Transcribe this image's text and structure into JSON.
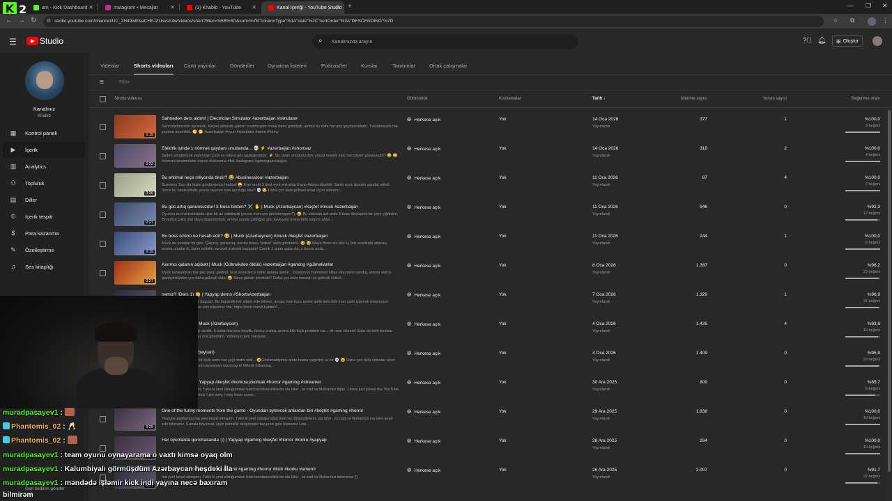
{
  "browser": {
    "tabs": [
      {
        "label": "am - Kick Dashboard",
        "color": "#53fc18"
      },
      {
        "label": "Instagram • Mesajlar",
        "color": "#d6249f"
      },
      {
        "label": "(3) Khabib - YouTube",
        "color": "#ff0000"
      },
      {
        "label": "Kanal içeriği - YouTube Studio",
        "color": "#ff0000"
      }
    ],
    "url": "studio.youtube.com/channel/UC_3H49wElsaCHEJZUsvsX4w/videos/short?filter=%5B%5D&sort=%7B\"columnType\"%3A\"date\"%2C\"sortOrder\"%3A\"DESCENDING\"%7D"
  },
  "overlay": {
    "kick_logo_letter": "K",
    "kick_logo_number": "2"
  },
  "header": {
    "logo_text": "Studio",
    "search_placeholder": "Kanalınızda arayın",
    "create_label": "Oluştur"
  },
  "sidebar": {
    "channel_name": "Kanalınız",
    "channel_handle": "Khabib",
    "items": [
      {
        "label": "Kontrol paneli",
        "icon": "dashboard-icon"
      },
      {
        "label": "İçerik",
        "icon": "content-icon"
      },
      {
        "label": "Analytics",
        "icon": "analytics-icon"
      },
      {
        "label": "Topluluk",
        "icon": "community-icon"
      },
      {
        "label": "Diller",
        "icon": "subtitles-icon"
      },
      {
        "label": "İçerik tespiti",
        "icon": "copyright-icon"
      },
      {
        "label": "Para kazanma",
        "icon": "monetization-icon"
      },
      {
        "label": "Özelleştirme",
        "icon": "customization-icon"
      },
      {
        "label": "Ses kitaplığı",
        "icon": "audio-library-icon"
      }
    ],
    "feedback_label": "Geri bildirim gönder"
  },
  "content_tabs": [
    "Videolar",
    "Shorts videoları",
    "Canlı yayınlar",
    "Gönderiler",
    "Oynatma listeleri",
    "Podcast'ler",
    "Kurslar",
    "Tanıtımlar",
    "Ortak çalışmalar"
  ],
  "active_tab": "Shorts videoları",
  "filter_placeholder": "Filtre",
  "columns": {
    "video": "Shorts videosu",
    "visibility": "Görünürlük",
    "restrictions": "Kısıtlamalar",
    "date": "Tarih",
    "views": "İzlenme sayısı",
    "comments": "Yorum sayısı",
    "likes": "Beğenme oranı"
  },
  "rows": [
    {
      "title": "Sahnədən dərs aldım! | Electrician Simulator #azerbaijan #simulator",
      "desc": "Sahnələrimizdən öyrənirik. Keçən videoda şəkləri unutmuşam məne baha gəlmişdi, amma bu dəfə hər şey qaydasındadır. Təhlükəsizlik hər şeyden önəmlidir. 😁 😁 #azerbaijan #oyun #simulator #tamir #funny",
      "duration": "0:19",
      "visibility": "Herkese açık",
      "restrictions": "Yok",
      "date": "14 Oca 2026",
      "date_status": "Yayınlandı",
      "views": "377",
      "comments": "1",
      "like_ratio": "%100,0",
      "like_count": "3 beğeni",
      "like_fraction": 1.0,
      "thumb": [
        "#8a3a22",
        "#d86a3a"
      ]
    },
    {
      "title": "Elektrik işində 1 nömrəli qaydanı unudanda... 💀 ⚡ #azerbaijan #shortsaz",
      "desc": "Şalteri söndürmək yadımdan çıxdı və nəticə göz qabağındadır. ⚡ Siz cisarı söndürürdün, yoxsa mənim kimi 'təcrübəni' güvənərdin? 😂 😂 #electriciansimulator #oyun #təkrurma #fail #azlagram #gamingazerbaijan",
      "duration": "0:22",
      "visibility": "Herkese açık",
      "restrictions": "Yok",
      "date": "14 Oca 2026",
      "date_status": "Yayınlandı",
      "views": "318",
      "comments": "2",
      "like_ratio": "%100,0",
      "like_count": "4 beğeni",
      "like_fraction": 1.0,
      "thumb": [
        "#4a4c6a",
        "#8a6f8a"
      ]
    },
    {
      "title": "Bu ehtimal neçə milyonda birdir? 😂 #businesstour #azerbaijan",
      "desc": "Business Tour-da bizim gördüyümüz hadisə! 😂 Eyni anda 3 dost eyni ərd-arda Kayıp Adaya düşdük. Sanki oyun bizimlə zarafat edirdi. Sizcə bu bəxtsizlikdir, yoxsa oyunun bizə qurduğu tələ? 💀 😂 Daha çox belə gülməli anlar üçün videonu...",
      "duration": "0:26",
      "visibility": "Herkese açık",
      "restrictions": "Yok",
      "date": "11 Oca 2026",
      "date_status": "Yayınlandı",
      "views": "87",
      "comments": "4",
      "like_ratio": "%100,0",
      "like_count": "7 beğeni",
      "like_fraction": 1.0,
      "thumb": [
        "#9aa08a",
        "#d8d8c0"
      ]
    },
    {
      "title": "Bu güc artıq qanunsuzdur! 3 Boss birden? ⚔️ ✋ | Muck (Azərbaycan) #keşfet #muck #azerbaijan",
      "desc": "Oyunun bu mərhələsində işlər bir az ciddiləşdi (yoxsa mən çox güclənmişəm?). 😂 Bu videoda ard-arda 3 boss döyüşünü bir yerə yığdıdım. Ərvvəlcə çətin olar deyə düşünürdüm, amma sonda çatdığım güc səviyyəsi mənə belə sürpriz oldu!...",
      "duration": "0:27",
      "visibility": "Herkese açık",
      "restrictions": "Yok",
      "date": "11 Oca 2026",
      "date_status": "Yayınlandı",
      "views": "946",
      "comments": "0",
      "like_ratio": "%92,3",
      "like_count": "12 beğeni",
      "like_fraction": 0.923,
      "thumb": [
        "#3a4a6a",
        "#7a8ab0"
      ]
    },
    {
      "title": "Bu boss özünü nə hesab edir? 😂 | Muck (Azərbaycan) #muck #keşfet #azerbaijan",
      "desc": "Muck-da sıradan bir gün; Qaçırıq, qorxuruq, axırda bossu \"paket\" edib göndəririk. 😂 😂 Wave Boss elə bilir ki, bizi asanlıqla udacaq, amma unudur ki, bizim millətin survival instinkti başqadır! Canlılı 1 qram qalsa da, o bossu orda...",
      "duration": "0:19",
      "visibility": "Herkese açık",
      "restrictions": "Yok",
      "date": "11 Oca 2026",
      "date_status": "Yayınlandı",
      "views": "244",
      "comments": "1",
      "like_ratio": "%100,0",
      "like_count": "6 beğeni",
      "like_fraction": 1.0,
      "thumb": [
        "#3a4a7a",
        "#8a9ac8"
      ]
    },
    {
      "title": "Axırıncı qalanın aqibəti | Muck (Gülməkdən öldük) #azerbaijan #gaming #gülməlianlar",
      "desc": "Muck oynayarkən hər şey yaxşı gedirdi, ta ki sona bircə nəfər qalana qədər... Dostumuz həmmisin killas ekacəyini sandıq, amma nəticə gözləyirmizdən çox daha gülməli oldu! 😂 Sizcə günah kimdedir? Daha çox belə maraqlı və gülməli videol...",
      "duration": "0:27",
      "visibility": "Herkese açık",
      "restrictions": "Yok",
      "date": "8 Oca 2026",
      "date_status": "Yayınlandı",
      "views": "1.387",
      "comments": "0",
      "like_ratio": "%96,2",
      "like_count": "25 beğeni",
      "like_fraction": 0.962,
      "thumb": [
        "#a0301a",
        "#e8a040"
      ]
    },
    {
      "title": "nəmiz? (Dərs 1) 👶 | Yapyap demo #ShortsAzerbaijan",
      "desc": "əşələm, hamı düçəktə başsarı. Bu harakətli hər adam edə bilməz, ancaq mən bura qədər gəlib belə bilə mən canlı izləmək istəyirsəsə aşağıdakı linkdən keçid edə bilərsiniz link: https://kick.com/Khabib00...",
      "duration": "0:27",
      "visibility": "Herkese açık",
      "restrictions": "Yok",
      "date": "7 Oca 2026",
      "date_status": "Yayınlandı",
      "views": "1.329",
      "comments": "1",
      "like_ratio": "%96,9",
      "like_count": "31 beğeni",
      "like_fraction": 0.969,
      "thumb": [
        "#2a2a3a",
        "#5a5a6a"
      ]
    },
    {
      "title": "mən ölürəm? 💀 | Muck (Azərbaycan)",
      "desc": "l bossu kəsməyə qərar verdik. 5 nəfər hücuma keçdik, bossu yıxdıq, amma bilir kiçik problem var... ək mən ölürəm! Sizin də belə bəxtsiz dostunuz var? Videonu ona göndərin. Videonun tam versiyası...",
      "duration": "0:27",
      "visibility": "Herkese açık",
      "restrictions": "Yok",
      "date": "4 Oca 2026",
      "date_status": "Yayınlandı",
      "views": "1.426",
      "comments": "4",
      "like_ratio": "%93,8",
      "like_count": "15 beğeni",
      "like_fraction": 0.938,
      "thumb": [
        "#2a2a3a",
        "#5a5a6a"
      ]
    },
    {
      "title": "qdıq! | Muck (Azərbaycan)",
      "desc": "ck oynayırdıq, amma bir kiçik səhv hər şeyi məhv etdi... 😂Gözlənədiyimiz anda bossu çağırdıq və bir 💀 😂 Daha çox belə videolar üçün kanala abune olmağı və bəyənməyi unutmayın! #Muck #Gaming...",
      "duration": "0:27",
      "visibility": "Herkese açık",
      "restrictions": "Yok",
      "date": "4 Oca 2026",
      "date_status": "Yayınlandı",
      "views": "1.409",
      "comments": "0",
      "like_ratio": "%95,8",
      "like_count": "23 beğeni",
      "like_fraction": 0.958,
      "thumb": [
        "#2a2a3a",
        "#5a5a6a"
      ]
    },
    {
      "title": "çik suprizi 😂 😂 | Yapyap #keşfet #korkusuzkorkak #horror #gaming #streamer",
      "desc": "ma yeni keçid etmişəm. Təbii ki yeni olduğumdan bədi təcrübəsizliklərim ola bilər , öz irad və fikirlərinizi ibjan. I have just joined the YouTube platform. Of course, since I am new, I may have some...",
      "duration": "0:27",
      "visibility": "Herkese açık",
      "restrictions": "Yok",
      "date": "30 Ara 2025",
      "date_status": "Yayınlandı",
      "views": "809",
      "comments": "0",
      "like_ratio": "%85,7",
      "like_count": "6 beğeni",
      "like_fraction": 0.857,
      "thumb": [
        "#2a2a3a",
        "#5a5a6a"
      ]
    },
    {
      "title": "One of the funny moments from the game - Oyundan əyləncəli anlardan biri #keşfet #gaming #horror",
      "desc": "Youtube platformasına yeni keçid etmişəm. Təbii ki yeni olduğumdan bədi təcrübəsizliklərim ola bilər , öz irad və fikirlərinizi rəy kimi qeyd edə bilərsiniz. Kanala böyümək üçün təkmillik istəyirənsiz buyurub gələ bilərsiniz Link...",
      "duration": "0:29",
      "visibility": "Herkese açık",
      "restrictions": "Yok",
      "date": "29 Ara 2025",
      "date_status": "Yayınlandı",
      "views": "1.838",
      "comments": "0",
      "like_ratio": "%100,0",
      "like_count": "19 beğeni",
      "like_fraction": 1.0,
      "thumb": [
        "#3a3040",
        "#7a6a80"
      ]
    },
    {
      "title": "Hər oyunlarda qorxmasanda :)) | Yapyap #gaming #keşfet #horror #korku #yapyap",
      "desc": "",
      "duration": "0:27",
      "visibility": "Herkese açık",
      "restrictions": "Yok",
      "date": "28 Ara 2025",
      "date_status": "Yayınlandı",
      "views": "264",
      "comments": "0",
      "like_ratio": "%100,0",
      "like_count": "10 beğeni",
      "like_fraction": 1.0,
      "thumb": [
        "#3a3040",
        "#6a5a70"
      ]
    },
    {
      "title": "2ci ən çox qorxduğum səhnə | Amenti #gaming #horror #kick #korku #amenti",
      "desc": "ma yeni keçid etmişəm. Təbii ki yeni olduğumdan bədi təcrübəsizliklərim ola bilər , öz irad və fikirlərinizi ibilərsiniz :))",
      "duration": "0:27",
      "visibility": "Herkese açık",
      "restrictions": "Yok",
      "date": "26 Ara 2025",
      "date_status": "Yayınlandı",
      "views": "2.007",
      "comments": "0",
      "like_ratio": "%91,7",
      "like_count": "22 beğeni",
      "like_fraction": 0.917,
      "thumb": [
        "#2a2a3a",
        "#5a5a6a"
      ]
    }
  ],
  "partial_top_duration": "0:17",
  "chat": [
    {
      "user": "muradpasayev1",
      "text": ":",
      "emote": true,
      "badge": false,
      "style": "u1"
    },
    {
      "user": "Phantomis_02",
      "text": ": 🥂",
      "emote": false,
      "badge": true,
      "style": "u2"
    },
    {
      "user": "Phantomis_02",
      "text": ":",
      "emote": true,
      "badge": true,
      "style": "u2"
    },
    {
      "user": "muradpasayev1",
      "text": ": team oyunu oynayarama o vaxtı kimsə oyaq olm",
      "emote": false,
      "badge": false,
      "style": "u1"
    },
    {
      "user": "muradpasayev1",
      "text": ": Kalumbiyalı görmüşdüm Azərbaycan heşdeki İla",
      "emote": false,
      "badge": false,
      "style": "u1"
    },
    {
      "user": "muradpasayev1",
      "text": ": məndədə işləmir kick indi yayına necə baxıram",
      "emote": false,
      "badge": false,
      "style": "u1"
    },
    {
      "user": "",
      "text": "bilmirəm",
      "emote": false,
      "badge": false,
      "style": "u1"
    }
  ]
}
